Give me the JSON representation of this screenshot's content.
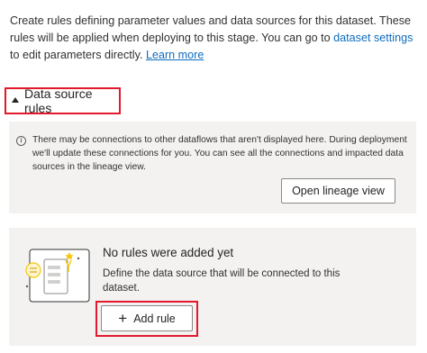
{
  "intro": {
    "text_before_link": "Create rules defining parameter values and data sources for this dataset. These rules will be applied when deploying to this stage. You can go to ",
    "dataset_settings_link": "dataset settings",
    "text_after_link": " to edit parameters directly. ",
    "learn_more_link": "Learn more"
  },
  "section": {
    "label": "Data source rules"
  },
  "info": {
    "icon": "info-icon",
    "message": "There may be connections to other dataflows that aren't displayed here. During deployment we'll update these connections for you. You can see all the connections and impacted data sources in the lineage view.",
    "button_label": "Open lineage view"
  },
  "empty_state": {
    "title": "No rules were added yet",
    "description": "Define the data source that will be connected to this dataset.",
    "add_button_label": "Add rule",
    "add_icon": "plus-icon"
  },
  "colors": {
    "highlight": "#e3182d",
    "link": "#0f6cbd",
    "panel_bg": "#f3f2f1",
    "illustration_accent": "#f2c811"
  }
}
